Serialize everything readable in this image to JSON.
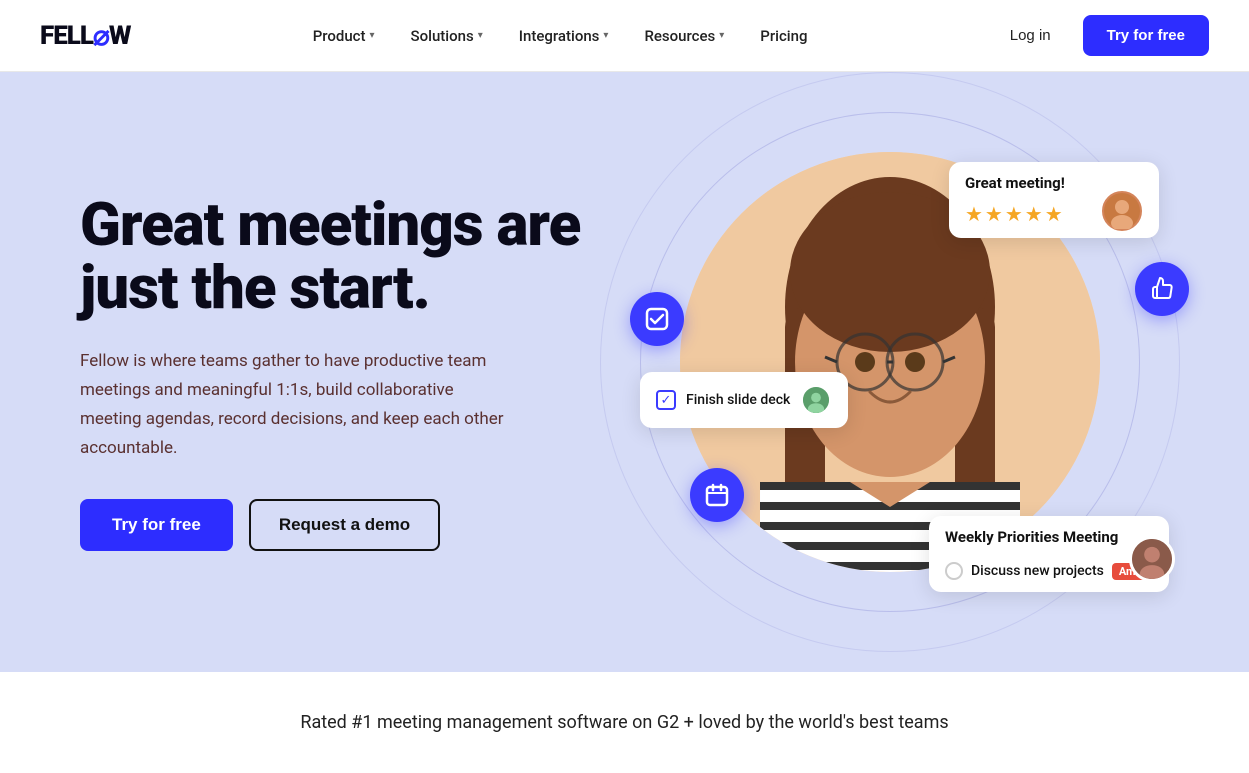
{
  "brand": {
    "name_part1": "FELL",
    "name_slash": "⌀",
    "name_part2": "W"
  },
  "nav": {
    "links": [
      {
        "label": "Product",
        "has_dropdown": true
      },
      {
        "label": "Solutions",
        "has_dropdown": true
      },
      {
        "label": "Integrations",
        "has_dropdown": true
      },
      {
        "label": "Resources",
        "has_dropdown": true
      },
      {
        "label": "Pricing",
        "has_dropdown": false
      }
    ],
    "login_label": "Log in",
    "try_label": "Try for free"
  },
  "hero": {
    "title": "Great meetings are just the start.",
    "description": "Fellow is where teams gather to have productive team meetings and meaningful 1:1s, build collaborative meeting agendas, record decisions, and keep each other accountable.",
    "btn_primary": "Try for free",
    "btn_secondary": "Request a demo"
  },
  "floating_ui": {
    "meeting_rating_label": "Great meeting!",
    "stars": "★★★★★",
    "finish_deck_label": "Finish slide deck",
    "weekly_meeting_title": "Weekly Priorities Meeting",
    "discuss_projects": "Discuss new projects",
    "amir_tag": "Amir"
  },
  "bottom": {
    "text": "Rated #1 meeting management software on G2 + loved by the world's best teams"
  }
}
